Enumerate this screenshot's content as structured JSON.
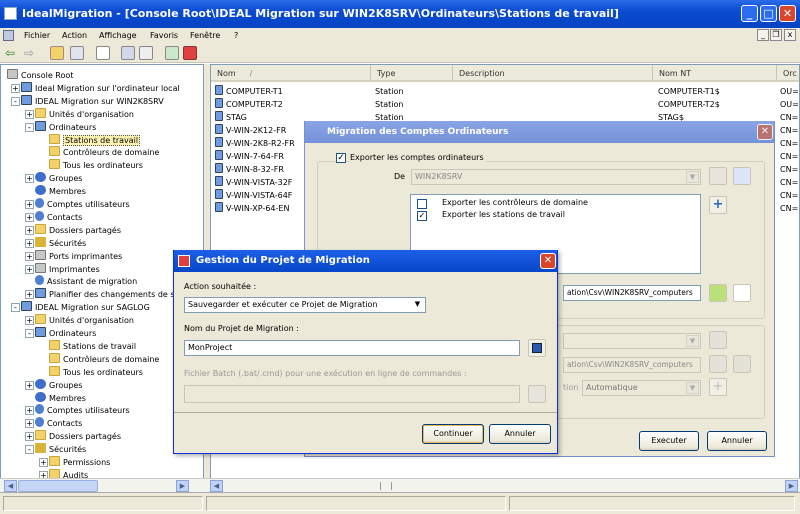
{
  "window": {
    "title": "IdealMigration - [Console Root\\IDEAL Migration sur WIN2K8SRV\\Ordinateurs\\Stations de travail]"
  },
  "menu": {
    "items": [
      "Fichier",
      "Action",
      "Affichage",
      "Favoris",
      "Fenêtre",
      "?"
    ]
  },
  "tree": {
    "items": [
      {
        "label": "Console Root",
        "icon": "console-icon",
        "depth": 0,
        "exp": ""
      },
      {
        "label": "Ideal Migration sur l'ordinateur local",
        "icon": "migration-icon",
        "depth": 1,
        "exp": "+"
      },
      {
        "label": "IDEAL Migration sur WIN2K8SRV",
        "icon": "migration-icon",
        "depth": 1,
        "exp": "-"
      },
      {
        "label": "Unités d'organisation",
        "icon": "ou-icon",
        "depth": 2,
        "exp": "+"
      },
      {
        "label": "Ordinateurs",
        "icon": "computer-icon",
        "depth": 2,
        "exp": "-"
      },
      {
        "label": "Stations de travail",
        "icon": "folder-icon",
        "depth": 3,
        "exp": "",
        "selected": true
      },
      {
        "label": "Contrôleurs de domaine",
        "icon": "folder-icon",
        "depth": 3,
        "exp": ""
      },
      {
        "label": "Tous les ordinateurs",
        "icon": "folder-icon",
        "depth": 3,
        "exp": ""
      },
      {
        "label": "Groupes",
        "icon": "group-icon",
        "depth": 2,
        "exp": "+"
      },
      {
        "label": "Membres",
        "icon": "group-icon",
        "depth": 2,
        "exp": ""
      },
      {
        "label": "Comptes utilisateurs",
        "icon": "user-icon",
        "depth": 2,
        "exp": "+"
      },
      {
        "label": "Contacts",
        "icon": "user-icon",
        "depth": 2,
        "exp": "+"
      },
      {
        "label": "Dossiers partagés",
        "icon": "folder-icon",
        "depth": 2,
        "exp": "+"
      },
      {
        "label": "Sécurités",
        "icon": "shield-icon",
        "depth": 2,
        "exp": "+"
      },
      {
        "label": "Ports imprimantes",
        "icon": "printer-icon",
        "depth": 2,
        "exp": "+"
      },
      {
        "label": "Imprimantes",
        "icon": "printer-icon",
        "depth": 2,
        "exp": "+"
      },
      {
        "label": "Assistant de migration",
        "icon": "wizard-icon",
        "depth": 2,
        "exp": ""
      },
      {
        "label": "Planifier des changements de s",
        "icon": "schedule-icon",
        "depth": 2,
        "exp": "+"
      },
      {
        "label": "IDEAL Migration sur SAGLOG",
        "icon": "migration-icon",
        "depth": 1,
        "exp": "-"
      },
      {
        "label": "Unités d'organisation",
        "icon": "ou-icon",
        "depth": 2,
        "exp": "+"
      },
      {
        "label": "Ordinateurs",
        "icon": "computer-icon",
        "depth": 2,
        "exp": "-"
      },
      {
        "label": "Stations de travail",
        "icon": "folder-icon",
        "depth": 3,
        "exp": ""
      },
      {
        "label": "Contrôleurs de domaine",
        "icon": "folder-icon",
        "depth": 3,
        "exp": ""
      },
      {
        "label": "Tous les ordinateurs",
        "icon": "folder-icon",
        "depth": 3,
        "exp": ""
      },
      {
        "label": "Groupes",
        "icon": "group-icon",
        "depth": 2,
        "exp": "+"
      },
      {
        "label": "Membres",
        "icon": "group-icon",
        "depth": 2,
        "exp": ""
      },
      {
        "label": "Comptes utilisateurs",
        "icon": "user-icon",
        "depth": 2,
        "exp": "+"
      },
      {
        "label": "Contacts",
        "icon": "user-icon",
        "depth": 2,
        "exp": "+"
      },
      {
        "label": "Dossiers partagés",
        "icon": "folder-icon",
        "depth": 2,
        "exp": "+"
      },
      {
        "label": "Sécurités",
        "icon": "shield-icon",
        "depth": 2,
        "exp": "-"
      },
      {
        "label": "Permissions",
        "icon": "folder-icon",
        "depth": 3,
        "exp": "+"
      },
      {
        "label": "Audits",
        "icon": "folder-icon",
        "depth": 3,
        "exp": "+"
      }
    ]
  },
  "list": {
    "columns": [
      "Nom",
      "Type",
      "Description",
      "Nom NT",
      "Orc"
    ],
    "rows": [
      {
        "name": "COMPUTER-T1",
        "type": "Station",
        "nt": "COMPUTER-T1$",
        "org": "OU="
      },
      {
        "name": "COMPUTER-T2",
        "type": "Station",
        "nt": "COMPUTER-T2$",
        "org": "OU="
      },
      {
        "name": "STAG",
        "type": "Station",
        "nt": "STAG$",
        "org": "CN="
      },
      {
        "name": "V-WIN-2K12-FR",
        "type": "",
        "nt": "",
        "org": "CN="
      },
      {
        "name": "V-WIN-2K8-R2-FR",
        "type": "",
        "nt": "",
        "org": "CN="
      },
      {
        "name": "V-WIN-7-64-FR",
        "type": "",
        "nt": "",
        "org": "CN="
      },
      {
        "name": "V-WIN-8-32-FR",
        "type": "",
        "nt": "",
        "org": "CN="
      },
      {
        "name": "V-WIN-VISTA-32F",
        "type": "",
        "nt": "",
        "org": "CN="
      },
      {
        "name": "V-WIN-VISTA-64F",
        "type": "",
        "nt": "",
        "org": "CN="
      },
      {
        "name": "V-WIN-XP-64-EN",
        "type": "",
        "nt": "",
        "org": "CN="
      }
    ]
  },
  "dlg_comptes": {
    "title": "Migration des Comptes Ordinateurs",
    "export_label": "Exporter les comptes ordinateurs",
    "de_label": "De",
    "de_value": "WIN2K8SRV",
    "options": [
      {
        "label": "Exporter les contrôleurs de domaine",
        "checked": false
      },
      {
        "label": "Exporter les stations de travail",
        "checked": true
      }
    ],
    "path1": "ation\\Csv\\WIN2K8SRV_computers",
    "path2": "ation\\Csv\\WIN2K8SRV_computers",
    "tion_label": "tion",
    "auto_value": "Automatique",
    "execute": "Executer",
    "cancel": "Annuler"
  },
  "dlg_projet": {
    "title": "Gestion du Projet de Migration",
    "action_label": "Action souhaitée :",
    "action_value": "Sauvegarder et exécuter ce Projet de Migration",
    "name_label": "Nom du Projet de Migration :",
    "name_value": "MonProject",
    "batch_label": "Fichier Batch (.bat/.cmd) pour une exécution en ligne de commandes :",
    "continue": "Continuer",
    "cancel": "Annuler"
  }
}
